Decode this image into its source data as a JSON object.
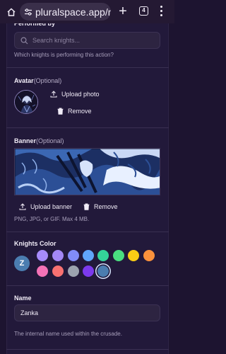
{
  "browser": {
    "url": "pluralspace.app/m",
    "tab_count": "4"
  },
  "performed_by": {
    "label": "Performed by",
    "search_placeholder": "Search knights...",
    "help": "Which knights is performing this action?"
  },
  "avatar": {
    "label": "Avatar",
    "optional": "(Optional)",
    "upload_label": "Upload photo",
    "remove_label": "Remove"
  },
  "banner": {
    "label": "Banner",
    "optional": "(Optional)",
    "upload_label": "Upload banner",
    "remove_label": "Remove",
    "help": "PNG, JPG, or GIF. Max 4 MB."
  },
  "color": {
    "label": "Knights Color",
    "badge_letter": "Z",
    "selected": "#4b7db0",
    "swatches": [
      "#a78bfa",
      "#a387f5",
      "#818cf8",
      "#60a5fa",
      "#34d399",
      "#4ade80",
      "#facc15",
      "#fb923c",
      "#f472b6",
      "#f87171",
      "#9ca3af",
      "#7c3aed",
      "#4b7db0"
    ]
  },
  "name": {
    "label": "Name",
    "value": "Zanka",
    "help": "The internal name used within the crusade."
  }
}
